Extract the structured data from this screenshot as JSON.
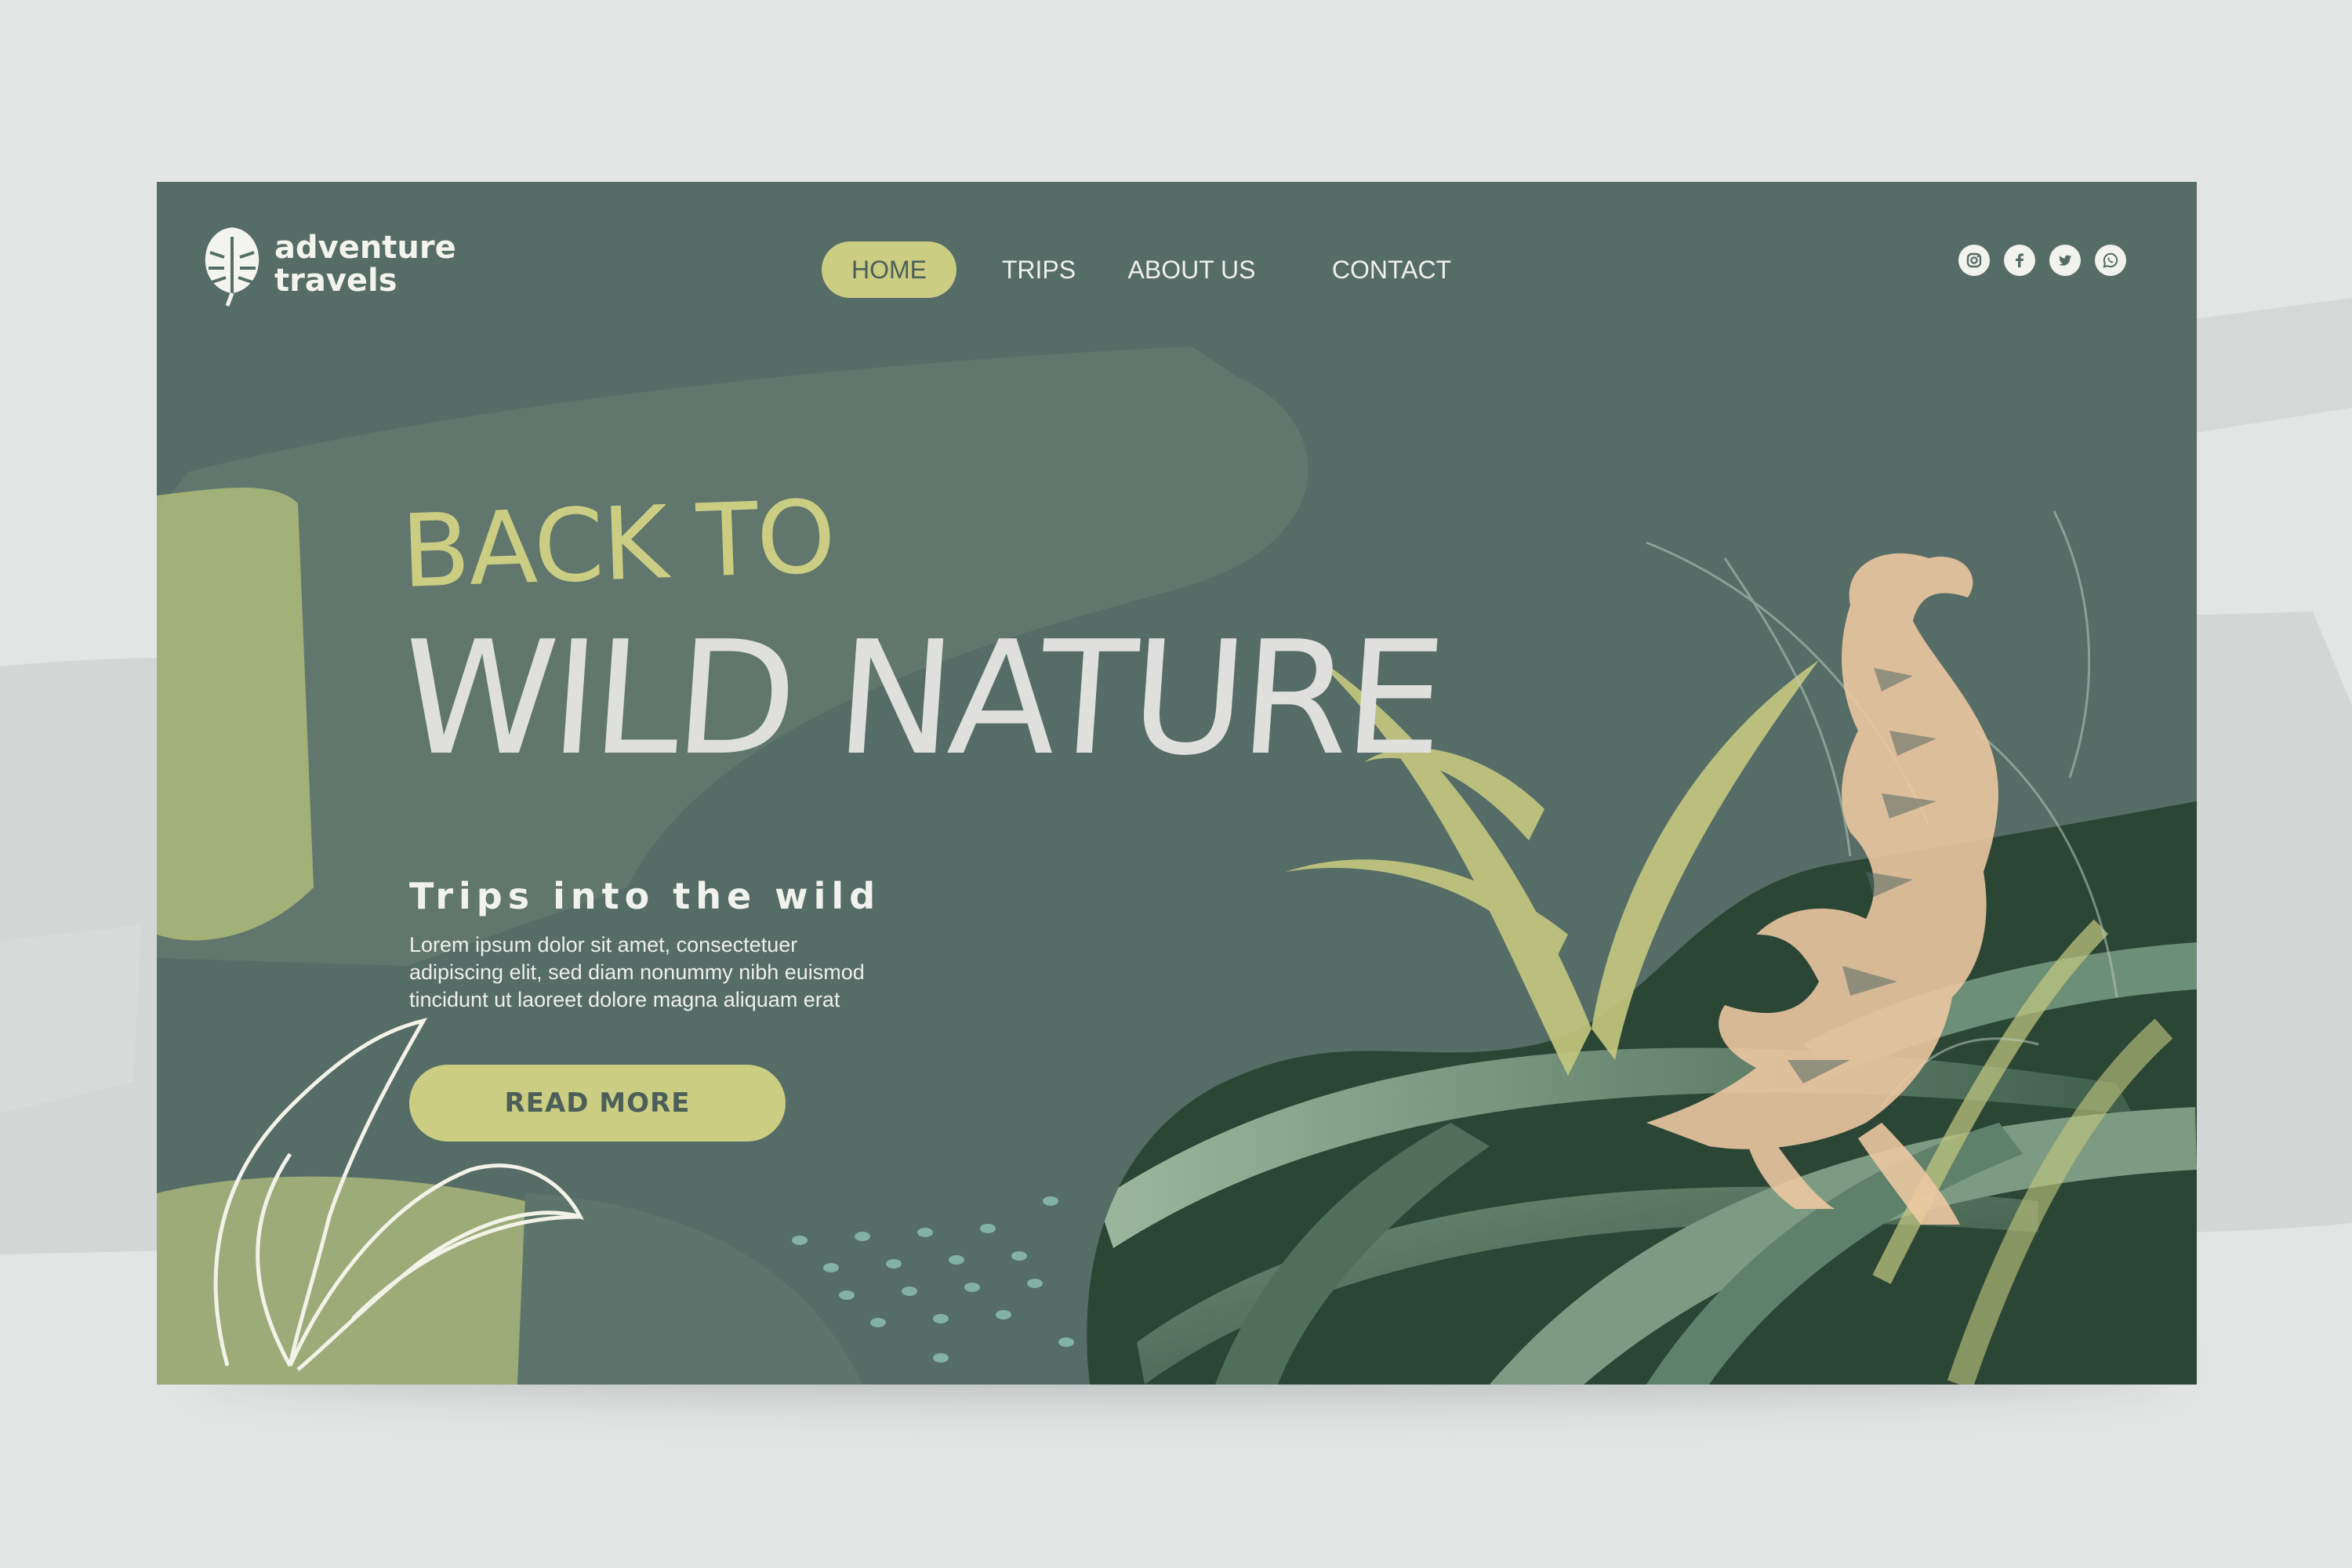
{
  "brand": {
    "line1": "adventure",
    "line2": "travels",
    "logo_icon": "monstera-leaf-icon"
  },
  "nav": {
    "items": [
      {
        "label": "HOME",
        "active": true
      },
      {
        "label": "TRIPS",
        "active": false
      },
      {
        "label": "ABOUT US",
        "active": false
      },
      {
        "label": "CONTACT",
        "active": false
      }
    ]
  },
  "social": [
    "instagram-icon",
    "facebook-icon",
    "twitter-icon",
    "whatsapp-icon"
  ],
  "hero": {
    "line1": "BACK TO",
    "line2": "WILD NATURE",
    "subtitle": "Trips into the wild",
    "body_lines": [
      "Lorem ipsum dolor sit amet, consectetuer",
      "adipiscing elit, sed diam nonummy nibh euismod",
      "tincidunt ut laoreet dolore magna aliquam erat"
    ],
    "cta_label": "READ MORE"
  },
  "colors": {
    "background": "#e3e4e4",
    "card": "#566c66",
    "accent": "#cbcd83",
    "text_light": "#eef0ec",
    "tiger": "#efc9a3"
  }
}
